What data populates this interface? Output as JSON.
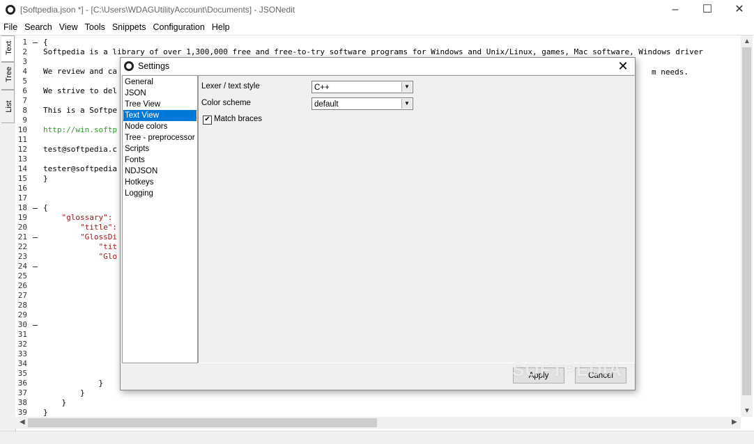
{
  "window": {
    "title": "[Softpedia.json *] - [C:\\Users\\WDAGUtilityAccount\\Documents] - JSONedit",
    "minimize_glyph": "–",
    "maximize_glyph": "☐",
    "close_glyph": "✕"
  },
  "menu": [
    "File",
    "Search",
    "View",
    "Tools",
    "Snippets",
    "Configuration",
    "Help"
  ],
  "side_tabs": [
    "Text",
    "Tree",
    "List"
  ],
  "editor": {
    "line_numbers": [
      "1",
      "2",
      "3",
      "4",
      "5",
      "6",
      "7",
      "8",
      "9",
      "10",
      "11",
      "12",
      "13",
      "14",
      "15",
      "16",
      "17",
      "18",
      "19",
      "20",
      "21",
      "22",
      "23",
      "24",
      "25",
      "26",
      "27",
      "28",
      "29",
      "30",
      "31",
      "32",
      "33",
      "34",
      "35",
      "36",
      "37",
      "38",
      "39"
    ],
    "lines": [
      {
        "text": "{",
        "style": "plain"
      },
      {
        "text": "Softpedia is a library of over 1,300,000 free and free-to-try software programs for Windows and Unix/Linux, games, Mac software, Windows driver",
        "style": "plain"
      },
      {
        "text": "",
        "style": "plain"
      },
      {
        "text": "We review and ca",
        "style": "plain"
      },
      {
        "text": "",
        "style": "plain"
      },
      {
        "text": "We strive to del",
        "style": "plain"
      },
      {
        "text": "",
        "style": "plain"
      },
      {
        "text": "This is a Softpe",
        "style": "plain"
      },
      {
        "text": "",
        "style": "plain"
      },
      {
        "text": "http://win.softp",
        "style": "url"
      },
      {
        "text": "",
        "style": "plain"
      },
      {
        "text": "test@softpedia.c",
        "style": "plain"
      },
      {
        "text": "",
        "style": "plain"
      },
      {
        "text": "tester@softpedia",
        "style": "plain"
      },
      {
        "text": "}",
        "style": "plain"
      },
      {
        "text": "",
        "style": "plain"
      },
      {
        "text": "",
        "style": "plain"
      },
      {
        "text": "{",
        "style": "plain"
      },
      {
        "text": "    \"glossary\":",
        "style": "str"
      },
      {
        "text": "        \"title\":",
        "style": "str"
      },
      {
        "text": "        \"GlossDi",
        "style": "str"
      },
      {
        "text": "            \"tit",
        "style": "str"
      },
      {
        "text": "            \"Glo",
        "style": "str"
      },
      {
        "text": "",
        "style": "plain"
      },
      {
        "text": "",
        "style": "plain"
      },
      {
        "text": "",
        "style": "plain"
      },
      {
        "text": "",
        "style": "plain"
      },
      {
        "text": "",
        "style": "plain"
      },
      {
        "text": "",
        "style": "plain"
      },
      {
        "text": "",
        "style": "plain"
      },
      {
        "text": "",
        "style": "plain"
      },
      {
        "text": "",
        "style": "plain"
      },
      {
        "text": "",
        "style": "plain"
      },
      {
        "text": "",
        "style": "plain"
      },
      {
        "text": "",
        "style": "plain"
      },
      {
        "text": "            }",
        "style": "plain"
      },
      {
        "text": "        }",
        "style": "plain"
      },
      {
        "text": "    }",
        "style": "plain"
      },
      {
        "text": "}",
        "style": "plain"
      }
    ],
    "overflow_line4_tail": "m needs."
  },
  "settings_dialog": {
    "title": "Settings",
    "categories": [
      "General",
      "JSON",
      "Tree View",
      "Text View",
      "Node colors",
      "Tree - preprocessor",
      "Scripts",
      "Fonts",
      "NDJSON",
      "Hotkeys",
      "Logging"
    ],
    "selected_category": "Text View",
    "lexer_label": "Lexer / text style",
    "lexer_value": "C++",
    "color_scheme_label": "Color scheme",
    "color_scheme_value": "default",
    "match_braces_label": "Match braces",
    "match_braces_checked": true,
    "check_mark": "✔",
    "apply_label": "Apply",
    "cancel_label": "Cancel"
  },
  "watermark": "SOFTPEDIA"
}
